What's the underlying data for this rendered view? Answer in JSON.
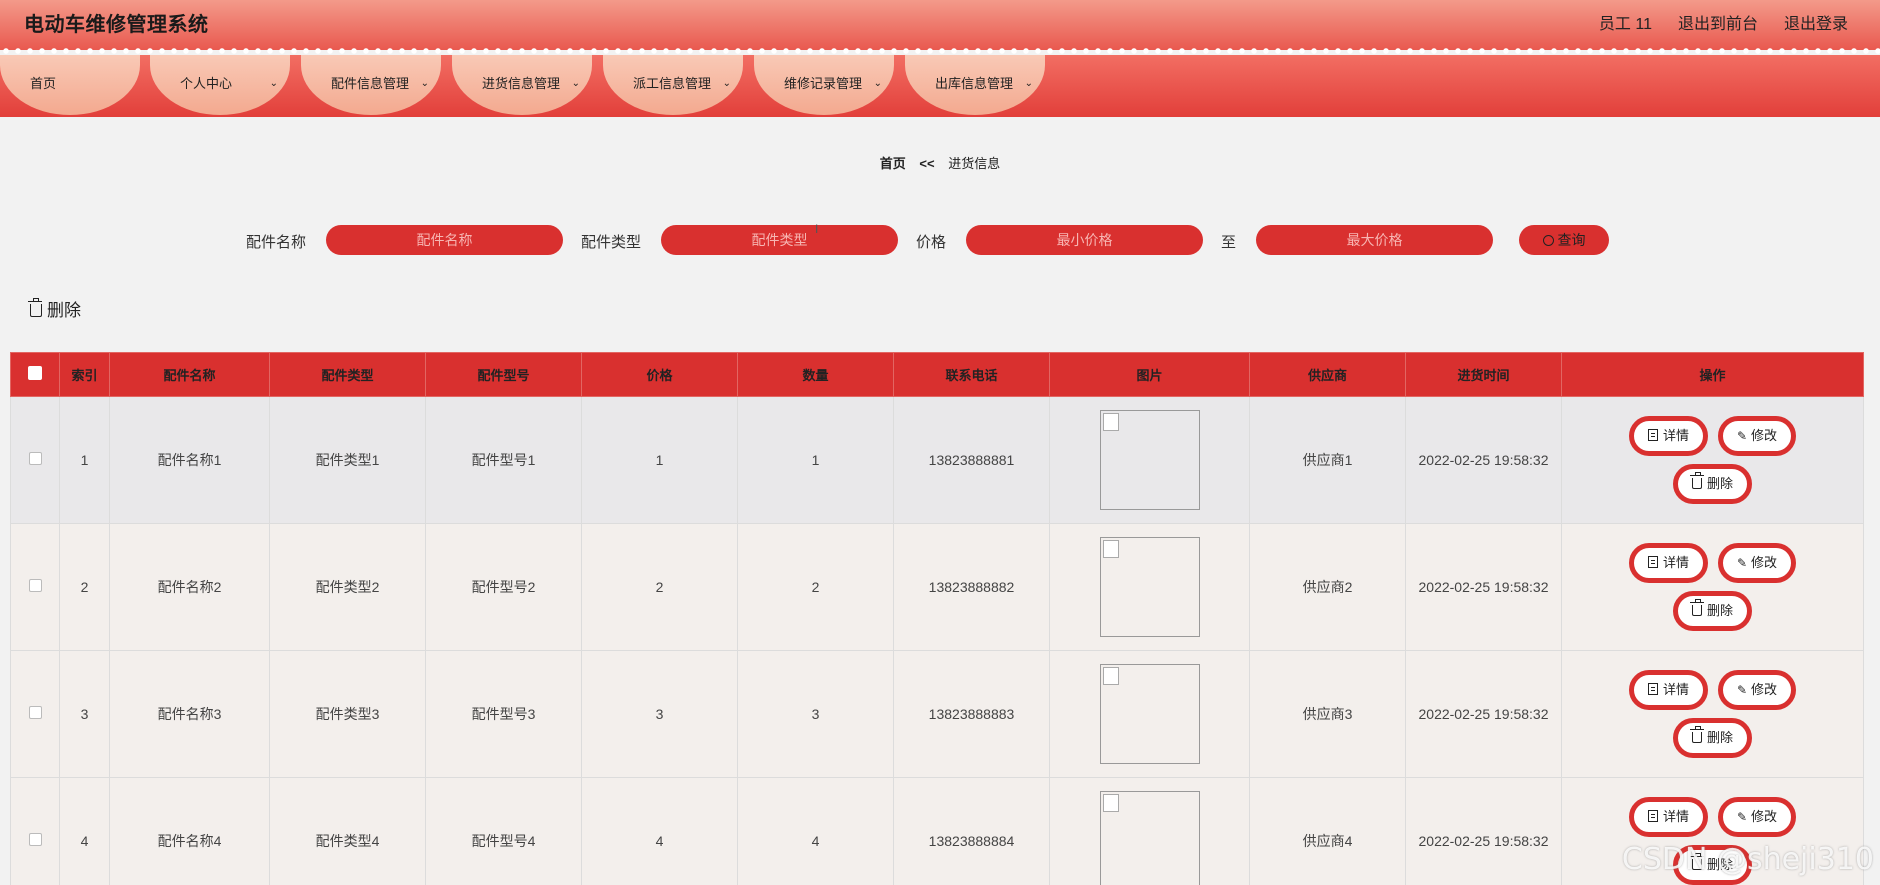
{
  "header": {
    "app_title": "电动车维修管理系统",
    "user_label": "员工 11",
    "back_front_label": "退出到前台",
    "logout_label": "退出登录"
  },
  "nav": [
    {
      "label": "首页",
      "has_dropdown": false
    },
    {
      "label": "个人中心",
      "has_dropdown": true
    },
    {
      "label": "配件信息管理",
      "has_dropdown": true
    },
    {
      "label": "进货信息管理",
      "has_dropdown": true
    },
    {
      "label": "派工信息管理",
      "has_dropdown": true
    },
    {
      "label": "维修记录管理",
      "has_dropdown": true
    },
    {
      "label": "出库信息管理",
      "has_dropdown": true
    }
  ],
  "breadcrumb": {
    "home": "首页",
    "sep": "<<",
    "current": "进货信息"
  },
  "search": {
    "name_label": "配件名称",
    "name_placeholder": "配件名称",
    "type_label": "配件类型",
    "type_placeholder": "配件类型",
    "price_label": "价格",
    "min_placeholder": "最小价格",
    "to_label": "至",
    "max_placeholder": "最大价格",
    "query_label": "查询"
  },
  "toolbar": {
    "delete_label": "删除"
  },
  "table": {
    "columns": [
      "索引",
      "配件名称",
      "配件类型",
      "配件型号",
      "价格",
      "数量",
      "联系电话",
      "图片",
      "供应商",
      "进货时间",
      "操作"
    ],
    "rows": [
      {
        "index": "1",
        "name": "配件名称1",
        "type": "配件类型1",
        "model": "配件型号1",
        "price": "1",
        "qty": "1",
        "phone": "13823888881",
        "supplier": "供应商1",
        "time": "2022-02-25 19:58:32"
      },
      {
        "index": "2",
        "name": "配件名称2",
        "type": "配件类型2",
        "model": "配件型号2",
        "price": "2",
        "qty": "2",
        "phone": "13823888882",
        "supplier": "供应商2",
        "time": "2022-02-25 19:58:32"
      },
      {
        "index": "3",
        "name": "配件名称3",
        "type": "配件类型3",
        "model": "配件型号3",
        "price": "3",
        "qty": "3",
        "phone": "13823888883",
        "supplier": "供应商3",
        "time": "2022-02-25 19:58:32"
      },
      {
        "index": "4",
        "name": "配件名称4",
        "type": "配件类型4",
        "model": "配件型号4",
        "price": "4",
        "qty": "4",
        "phone": "13823888884",
        "supplier": "供应商4",
        "time": "2022-02-25 19:58:32"
      }
    ],
    "actions": {
      "detail": "详情",
      "edit": "修改",
      "delete": "删除"
    }
  },
  "watermark": "CSDN @sheji310",
  "colors": {
    "accent": "#d9302f",
    "header_top": "#f39a8a",
    "nav_tab": "#f9c9b6",
    "page_bg": "#f2f2f2"
  }
}
